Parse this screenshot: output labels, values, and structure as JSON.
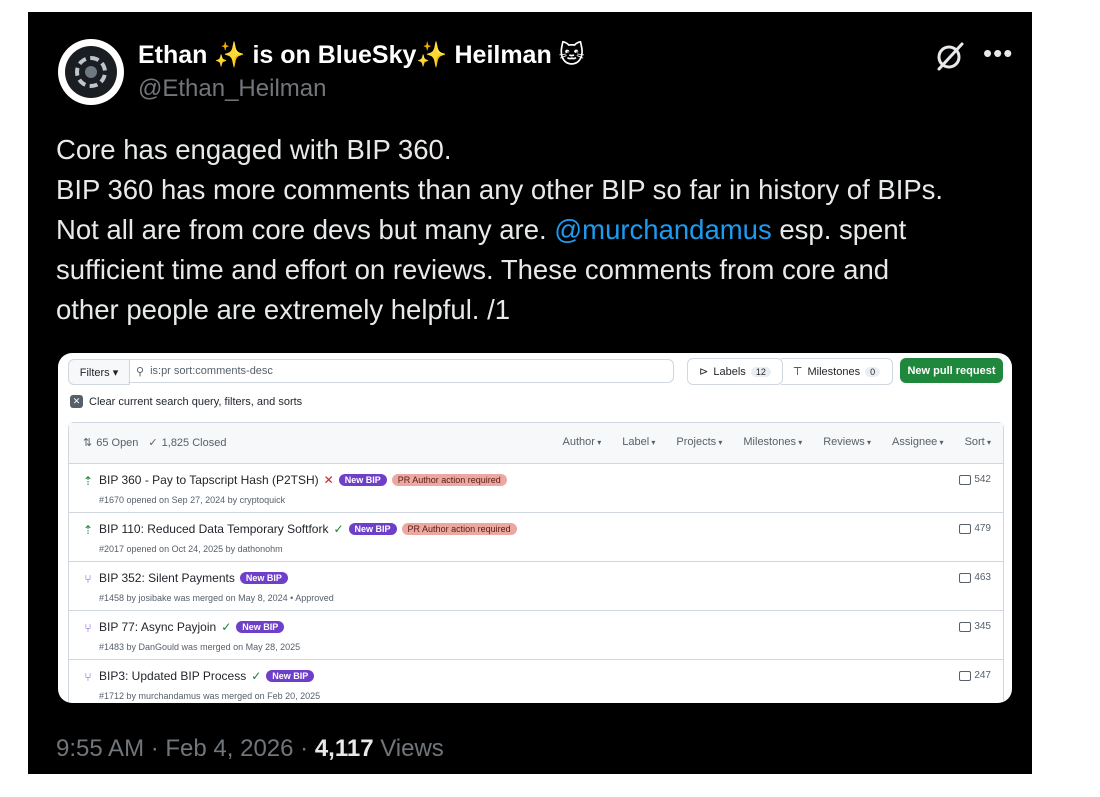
{
  "author": {
    "name": "Ethan ✨ is on BlueSky✨ Heilman 🐱",
    "handle": "@Ethan_Heilman"
  },
  "icons": {
    "grok": "grok-icon",
    "more": "more-icon"
  },
  "tweet": {
    "line1": "Core has engaged with BIP 360.",
    "line2": "BIP 360 has more  comments than any other BIP so far in history of BIPs.",
    "line3_pre": "Not all are from core devs but many are. ",
    "mention": "@murchandamus",
    "line3_post": " esp. spent",
    "line4": "sufficient time and effort on reviews. These comments from core and",
    "line5": "other people are extremely helpful. /1"
  },
  "github": {
    "filters_label": "Filters ▾",
    "search_value": "is:pr sort:comments-desc",
    "labels_label": "Labels",
    "labels_count": "12",
    "milestones_label": "Milestones",
    "milestones_count": "0",
    "new_pr_label": "New pull request",
    "clear_label": "Clear current search query, filters, and sorts",
    "open_label": "65 Open",
    "closed_label": "1,825 Closed",
    "header_filters": [
      "Author",
      "Label",
      "Projects",
      "Milestones",
      "Reviews",
      "Assignee",
      "Sort"
    ],
    "rows": [
      {
        "title": "BIP 360 - Pay to Tapscript Hash (P2TSH)",
        "meta": "#1670 opened on Sep 27, 2024 by cryptoquick",
        "comments": "542"
      },
      {
        "title": "BIP 110: Reduced Data Temporary Softfork",
        "meta": "#2017 opened on Oct 24, 2025 by dathonohm",
        "comments": "479"
      },
      {
        "title": "BIP 352: Silent Payments",
        "meta": "#1458 by josibake was merged on May 8, 2024 • Approved",
        "comments": "463"
      },
      {
        "title": "BIP 77: Async Payjoin",
        "meta": "#1483 by DanGould was merged on May 28, 2025",
        "comments": "345"
      },
      {
        "title": "BIP3: Updated BIP Process",
        "meta": "#1712 by murchandamus was merged on Feb 20, 2025",
        "comments": "247"
      }
    ],
    "badge_new_bip": "New BIP",
    "badge_author_action": "PR Author action required",
    "colors": {
      "green": "#1f883d",
      "purple": "#6e40c9",
      "red_badge": "#eba8a1"
    }
  },
  "footer": {
    "time": "9:55 AM · Feb 4, 2026 · ",
    "views_count": "4,117",
    "views_label": " Views"
  }
}
